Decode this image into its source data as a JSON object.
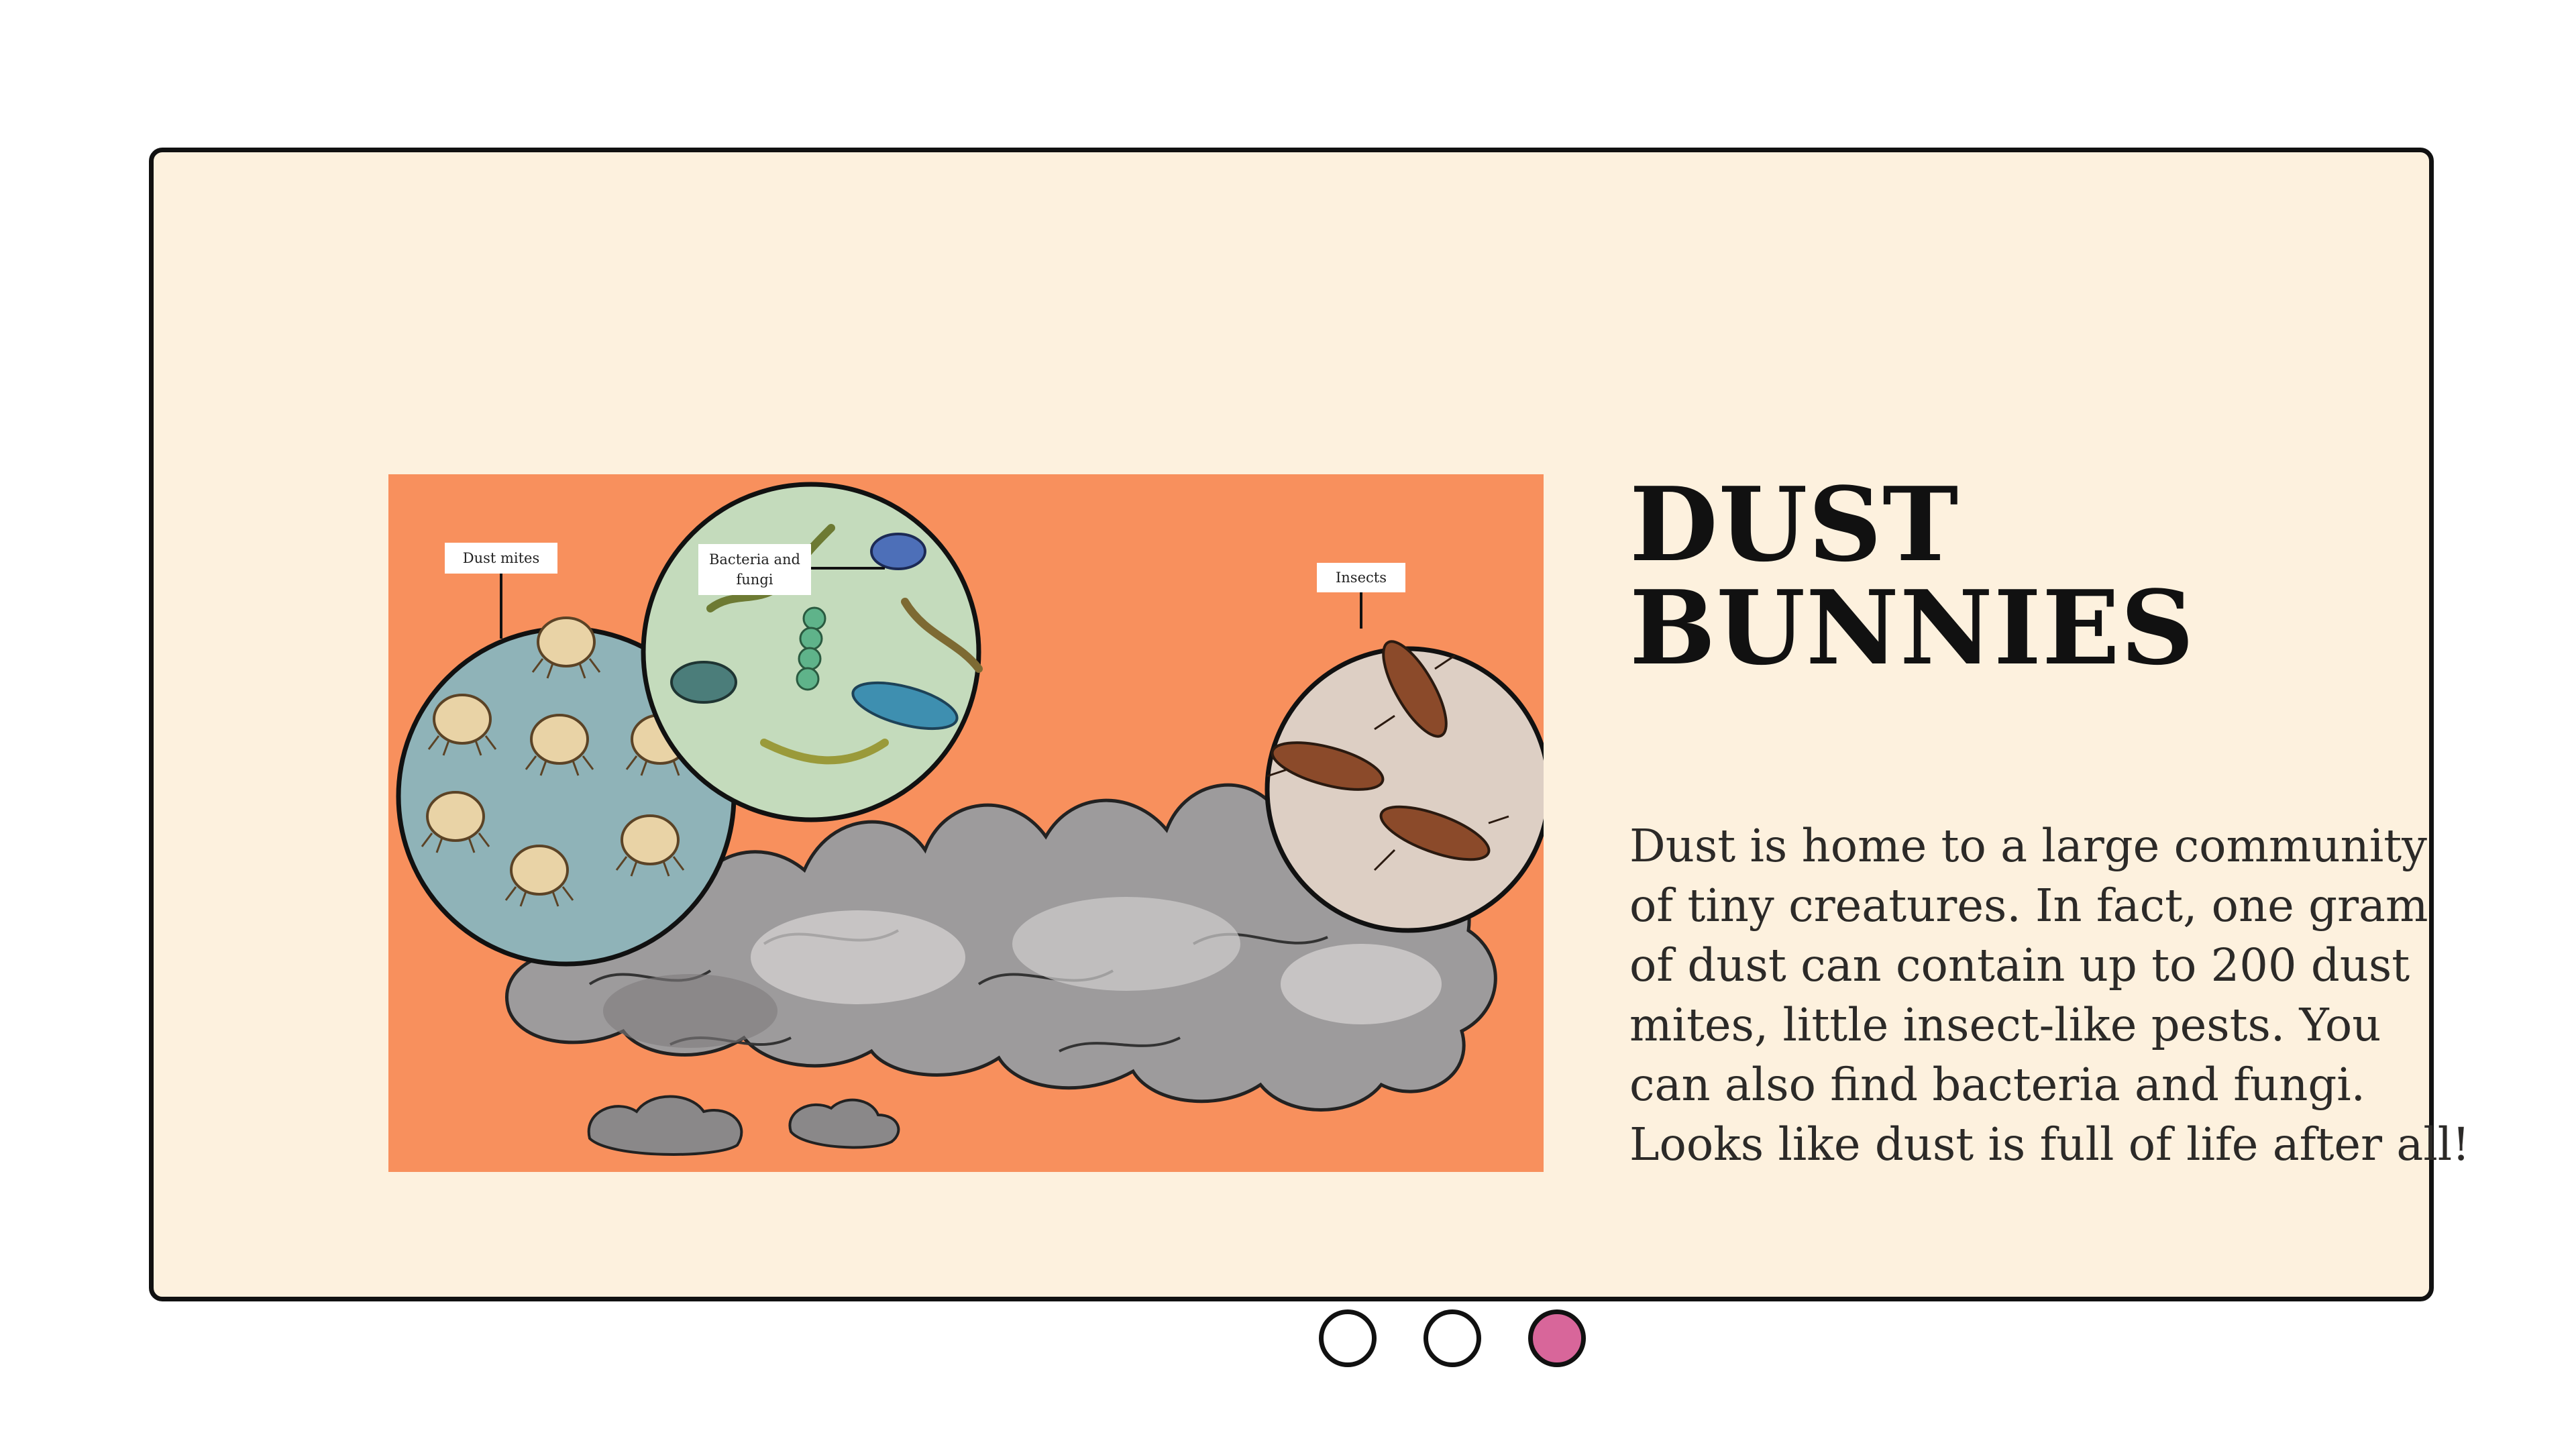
{
  "slide": {
    "title_lines": [
      "DUST",
      "BUNNIES"
    ],
    "body_lines": [
      "Dust is home to a large community",
      "of tiny creatures. In fact, one gram",
      "of dust can contain up to 200 dust",
      "mites, little insect-like pests. You",
      "can also find bacteria and fungi.",
      "Looks like dust is full of life after all!"
    ]
  },
  "illustration": {
    "labels": {
      "dust_mites": "Dust mites",
      "bacteria_line1": "Bacteria and",
      "bacteria_line2": "fungi",
      "insects": "Insects"
    }
  },
  "carousel": {
    "dots": [
      {
        "active": false
      },
      {
        "active": false
      },
      {
        "active": true
      }
    ],
    "active_color": "#d8669a"
  },
  "colors": {
    "card_background": "#fdf1de",
    "illustration_background": "#f79663"
  }
}
